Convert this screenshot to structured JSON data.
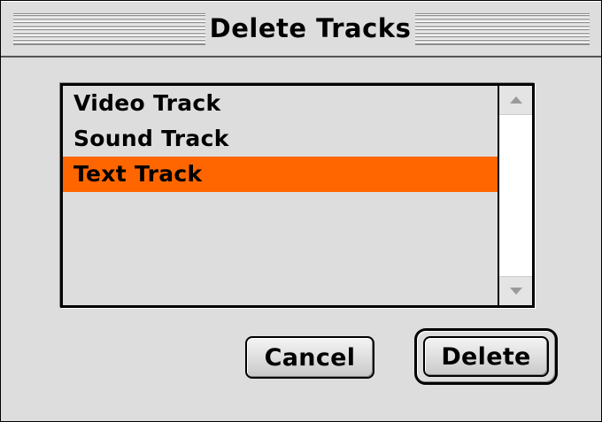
{
  "window": {
    "title": "Delete Tracks"
  },
  "track_list": {
    "items": [
      {
        "label": "Video Track",
        "selected": false
      },
      {
        "label": "Sound Track",
        "selected": false
      },
      {
        "label": "Text Track",
        "selected": true
      }
    ],
    "selection_color": "#ff6600"
  },
  "scrollbar": {
    "up_icon": "scroll-up-arrow",
    "down_icon": "scroll-down-arrow"
  },
  "buttons": {
    "cancel_label": "Cancel",
    "delete_label": "Delete",
    "default_button": "Delete"
  }
}
